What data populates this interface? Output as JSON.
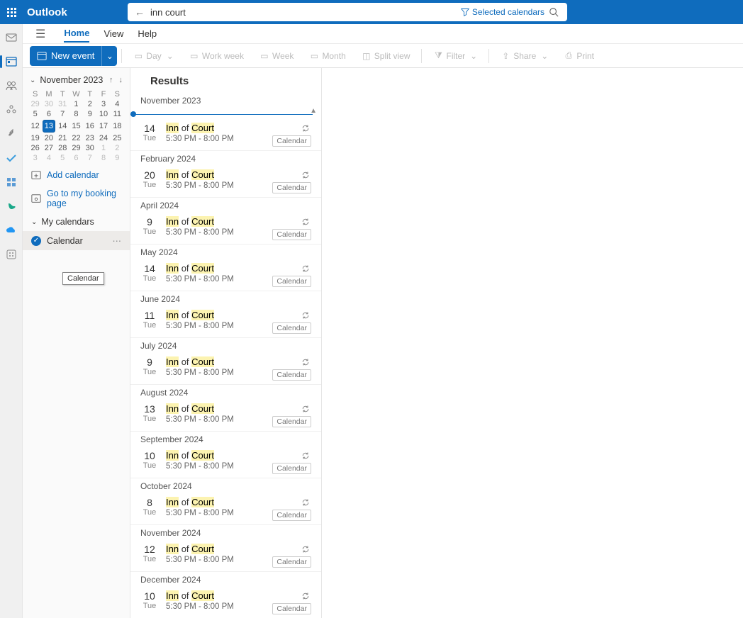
{
  "brand": "Outlook",
  "search": {
    "value": "inn court",
    "filter": "Selected calendars"
  },
  "tabs": {
    "home": "Home",
    "view": "View",
    "help": "Help"
  },
  "toolbar": {
    "new": "New event",
    "day": "Day",
    "workweek": "Work week",
    "week": "Week",
    "month": "Month",
    "splitview": "Split view",
    "filter": "Filter",
    "share": "Share",
    "print": "Print"
  },
  "minical": {
    "month": "November 2023",
    "dow": [
      "S",
      "M",
      "T",
      "W",
      "T",
      "F",
      "S"
    ],
    "rows": [
      [
        {
          "n": "29",
          "dim": true
        },
        {
          "n": "30",
          "dim": true
        },
        {
          "n": "31",
          "dim": true
        },
        {
          "n": "1"
        },
        {
          "n": "2"
        },
        {
          "n": "3"
        },
        {
          "n": "4"
        }
      ],
      [
        {
          "n": "5"
        },
        {
          "n": "6"
        },
        {
          "n": "7"
        },
        {
          "n": "8"
        },
        {
          "n": "9"
        },
        {
          "n": "10"
        },
        {
          "n": "11"
        }
      ],
      [
        {
          "n": "12"
        },
        {
          "n": "13",
          "today": true
        },
        {
          "n": "14"
        },
        {
          "n": "15"
        },
        {
          "n": "16"
        },
        {
          "n": "17"
        },
        {
          "n": "18"
        }
      ],
      [
        {
          "n": "19"
        },
        {
          "n": "20"
        },
        {
          "n": "21"
        },
        {
          "n": "22"
        },
        {
          "n": "23"
        },
        {
          "n": "24"
        },
        {
          "n": "25"
        }
      ],
      [
        {
          "n": "26"
        },
        {
          "n": "27"
        },
        {
          "n": "28"
        },
        {
          "n": "29"
        },
        {
          "n": "30"
        },
        {
          "n": "1",
          "dim": true
        },
        {
          "n": "2",
          "dim": true
        }
      ],
      [
        {
          "n": "3",
          "dim": true
        },
        {
          "n": "4",
          "dim": true
        },
        {
          "n": "5",
          "dim": true
        },
        {
          "n": "6",
          "dim": true
        },
        {
          "n": "7",
          "dim": true
        },
        {
          "n": "8",
          "dim": true
        },
        {
          "n": "9",
          "dim": true
        }
      ]
    ]
  },
  "sidebar": {
    "addcal": "Add calendar",
    "booking": "Go to my booking page",
    "mycals": "My calendars",
    "cal": "Calendar",
    "tooltip": "Calendar"
  },
  "results": {
    "header": "Results",
    "title_pre": "Inn",
    "title_mid": " of ",
    "title_post": "Court",
    "time": "5:30 PM - 8:00 PM",
    "badge": "Calendar",
    "groups": [
      {
        "label": "November 2023",
        "day": "14",
        "dow": "Tue"
      },
      {
        "label": "February 2024",
        "day": "20",
        "dow": "Tue"
      },
      {
        "label": "April 2024",
        "day": "9",
        "dow": "Tue"
      },
      {
        "label": "May 2024",
        "day": "14",
        "dow": "Tue"
      },
      {
        "label": "June 2024",
        "day": "11",
        "dow": "Tue"
      },
      {
        "label": "July 2024",
        "day": "9",
        "dow": "Tue"
      },
      {
        "label": "August 2024",
        "day": "13",
        "dow": "Tue"
      },
      {
        "label": "September 2024",
        "day": "10",
        "dow": "Tue"
      },
      {
        "label": "October 2024",
        "day": "8",
        "dow": "Tue"
      },
      {
        "label": "November 2024",
        "day": "12",
        "dow": "Tue"
      },
      {
        "label": "December 2024",
        "day": "10",
        "dow": "Tue"
      }
    ]
  }
}
